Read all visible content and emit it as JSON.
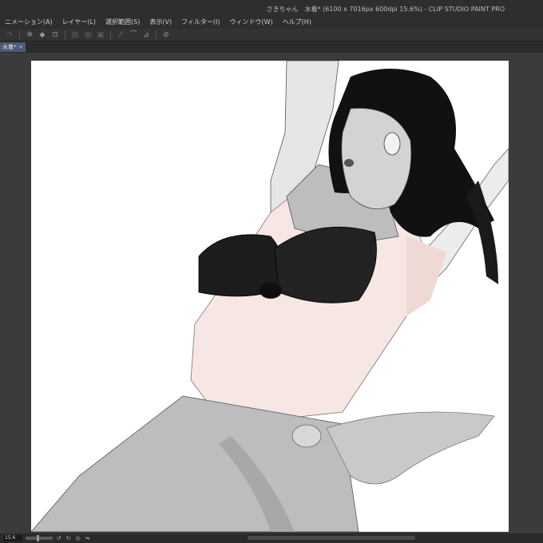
{
  "window": {
    "title": "さきちゃん　水着* (6100 x 7016px 600dpi 15.6%)  - CLIP STUDIO PAINT PRO"
  },
  "menu": {
    "items": [
      "ニメーション(A)",
      "レイヤー(L)",
      "選択範囲(S)",
      "表示(V)",
      "フィルター(I)",
      "ウィンドウ(W)",
      "ヘルプ(H)"
    ]
  },
  "toolbar": {
    "icons": [
      "redo-icon",
      "loading-spinner-icon",
      "fill-icon",
      "transform-icon",
      "select-all-icon",
      "deselect-icon",
      "invert-selection-icon",
      "ruler-icon",
      "curve-ruler-icon",
      "perspective-ruler-icon",
      "snap-icon"
    ]
  },
  "tab": {
    "label": "水着*",
    "close": "×"
  },
  "statusbar": {
    "zoom": "15.6"
  },
  "colors": {
    "background": "#3b3b3b",
    "titlebar": "#2e2e2e",
    "tab_active": "#4d5a78",
    "canvas": "#ffffff"
  }
}
